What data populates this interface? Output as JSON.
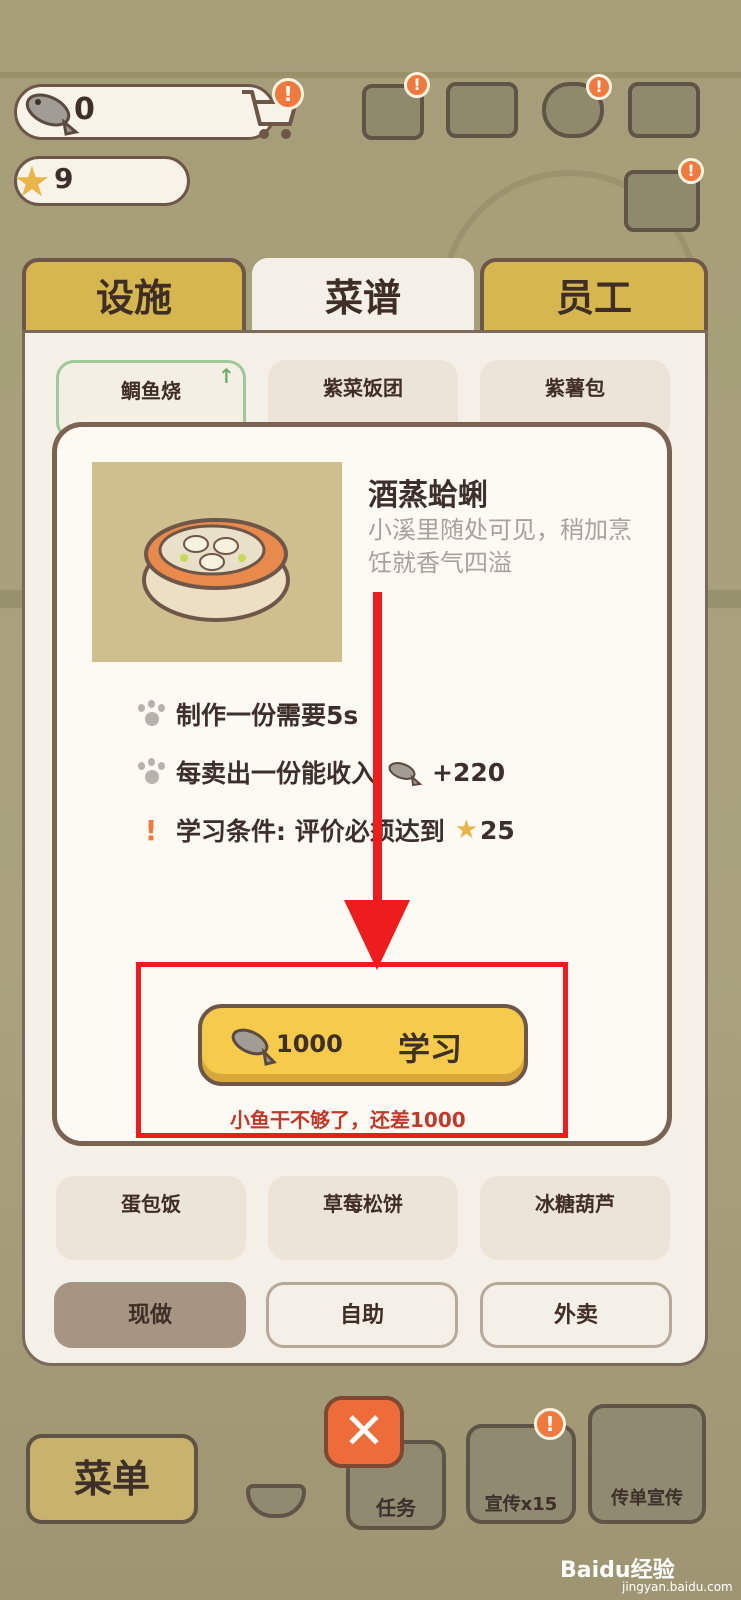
{
  "resources": {
    "fish_count": "0",
    "star_count": "9",
    "cart_badge": "!",
    "book_badge": "!",
    "gear_badge": "!",
    "sort_badge": "!"
  },
  "tabs": [
    {
      "label": "设施",
      "active": false
    },
    {
      "label": "菜谱",
      "active": true
    },
    {
      "label": "员工",
      "active": false
    }
  ],
  "recipes_top": [
    "鲷鱼烧",
    "紫菜饭团",
    "紫薯包"
  ],
  "recipes_bottom": [
    "蛋包饭",
    "草莓松饼",
    "冰糖葫芦"
  ],
  "modes": [
    {
      "label": "现做",
      "active": true
    },
    {
      "label": "自助",
      "active": false
    },
    {
      "label": "外卖",
      "active": false
    }
  ],
  "popup": {
    "name": "酒蒸蛤蜊",
    "description": "小溪里随处可见，稍加烹饪就香气四溢",
    "make_time": "制作一份需要5s",
    "income_label": "每卖出一份能收入",
    "income_value": "+220",
    "requirement_label": "学习条件: 评价必须达到",
    "requirement_value": "25",
    "learn_price": "1000",
    "learn_label": "学习",
    "warning": "小鱼干不够了，还差1000"
  },
  "bottom_bar": {
    "menu_label": "菜单",
    "task_label": "任务",
    "promo_label": "宣传x15",
    "flyer_label": "传单宣传",
    "promo_badge": "!",
    "close_symbol": "✕"
  },
  "watermark": {
    "main": "Baidu经验",
    "sub": "jingyan.baidu.com"
  },
  "colors": {
    "accent_yellow": "#f6cb4c",
    "tab_gold": "#d6b64e",
    "annotation_red": "#ee1c1c",
    "badge_orange": "#f07a3e",
    "warning_red": "#c0392b"
  }
}
